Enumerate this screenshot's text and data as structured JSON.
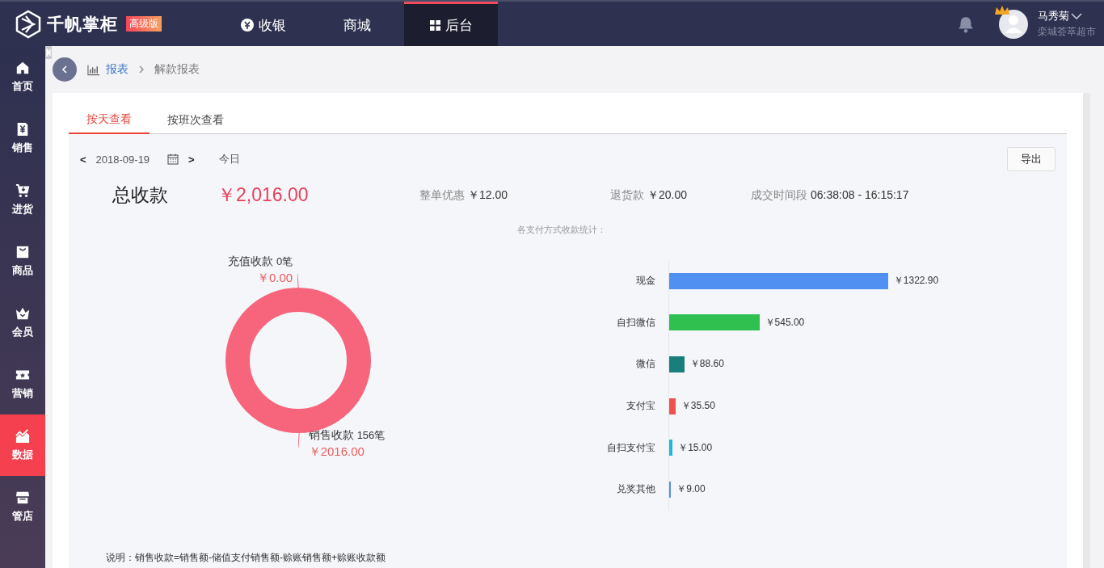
{
  "header": {
    "brand": "千帆掌柜",
    "edition_badge": "高级版",
    "nav": [
      {
        "label": "收银",
        "selected": false
      },
      {
        "label": "商城",
        "selected": false
      },
      {
        "label": "后台",
        "selected": true
      }
    ],
    "user": {
      "name": "马秀菊",
      "store": "栾城荟萃超市"
    }
  },
  "sidebar": {
    "items": [
      {
        "label": "首页",
        "selected": false
      },
      {
        "label": "销售",
        "selected": false
      },
      {
        "label": "进货",
        "selected": false
      },
      {
        "label": "商品",
        "selected": false
      },
      {
        "label": "会员",
        "selected": false
      },
      {
        "label": "营销",
        "selected": false
      },
      {
        "label": "数据",
        "selected": true
      },
      {
        "label": "管店",
        "selected": false
      }
    ]
  },
  "breadcrumb": [
    "报表",
    "解款报表"
  ],
  "tabs": [
    {
      "label": "按天查看",
      "selected": true
    },
    {
      "label": "按班次查看",
      "selected": false
    }
  ],
  "date_bar": {
    "prev": "<",
    "date": "2018-09-19",
    "next": ">",
    "today": "今日",
    "export": "导出"
  },
  "summary": {
    "title": "总收款",
    "total": "￥2,016.00",
    "items": [
      {
        "label": "整单优惠",
        "value": "￥12.00"
      },
      {
        "label": "退货款",
        "value": "￥20.00"
      },
      {
        "label": "成交时间段",
        "value": "06:38:08 - 16:15:17"
      }
    ]
  },
  "donut": {
    "slices": [
      {
        "name": "充值收款",
        "count": "0笔",
        "amount": "￥0.00"
      },
      {
        "name": "销售收款",
        "count": "156笔",
        "amount": "￥2016.00"
      }
    ]
  },
  "payment_stats": {
    "title": "各支付方式收款统计：",
    "bars": [
      {
        "label": "现金",
        "amount": "￥1322.90",
        "level": 0.59,
        "color": "#5090f0"
      },
      {
        "label": "自扫微信",
        "amount": "￥545.00",
        "level": 0.243,
        "color": "#30c050"
      },
      {
        "label": "微信",
        "amount": "￥88.60",
        "level": 0.041,
        "color": "#1a7f7a"
      },
      {
        "label": "支付宝",
        "amount": "￥35.50",
        "level": 0.017,
        "color": "#f25050"
      },
      {
        "label": "自扫支付宝",
        "amount": "￥15.00",
        "level": 0.009,
        "color": "#20b8d8"
      },
      {
        "label": "兑奖其他",
        "amount": "￥9.00",
        "level": 0.005,
        "color": "#5a8ee0"
      }
    ]
  },
  "note": "说明：销售收款=销售额-储值支付销售额-赊账销售额+赊账收款额"
}
